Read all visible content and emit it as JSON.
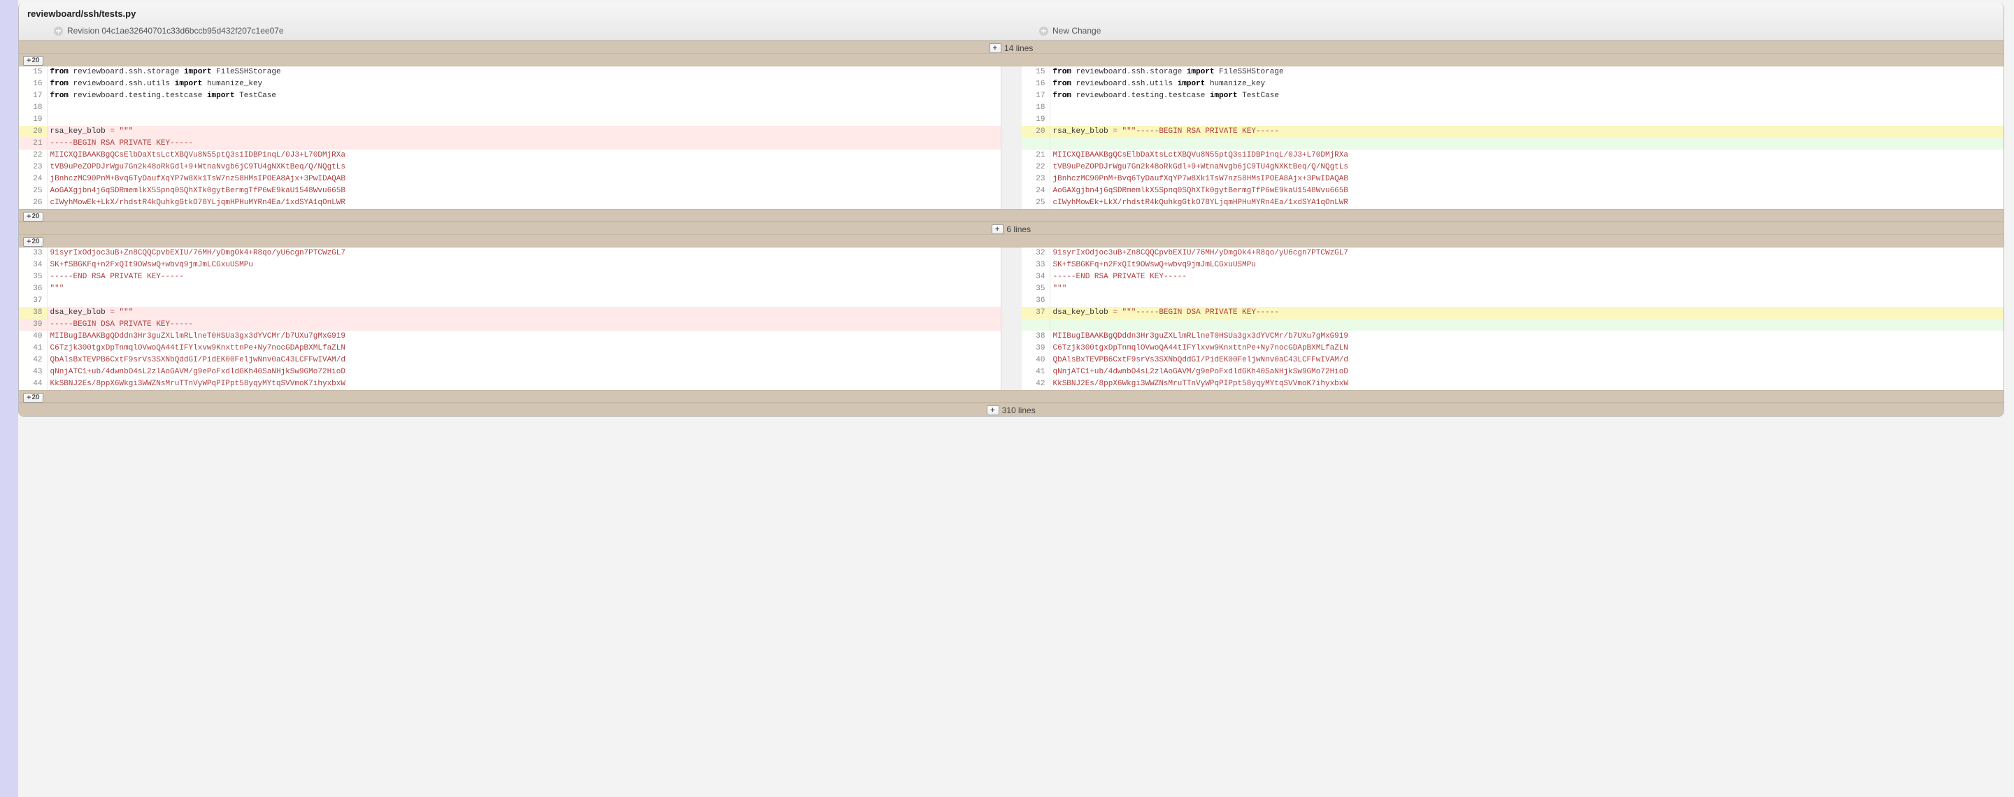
{
  "file_path": "reviewboard/ssh/tests.py",
  "revision_left_label": "Revision 04c1ae32640701c33d6bccb95d432f207c1ee07e",
  "revision_right_label": "New Change",
  "expand_top_lines": "14 lines",
  "expand_mid_lines": "6 lines",
  "expand_bottom_lines": "310 lines",
  "expand_btn_20": "20",
  "diff": {
    "rows": [
      {
        "type": "context",
        "ln_l": "15",
        "ln_r": "15",
        "l": "from reviewboard.ssh.storage import FileSSHStorage",
        "r": "from reviewboard.ssh.storage import FileSSHStorage",
        "kind": "imp"
      },
      {
        "type": "context",
        "ln_l": "16",
        "ln_r": "16",
        "l": "from reviewboard.ssh.utils import humanize_key",
        "r": "from reviewboard.ssh.utils import humanize_key",
        "kind": "imp"
      },
      {
        "type": "context",
        "ln_l": "17",
        "ln_r": "17",
        "l": "from reviewboard.testing.testcase import TestCase",
        "r": "from reviewboard.testing.testcase import TestCase",
        "kind": "imp"
      },
      {
        "type": "context",
        "ln_l": "18",
        "ln_r": "18",
        "l": "",
        "r": "",
        "kind": "blank"
      },
      {
        "type": "context",
        "ln_l": "19",
        "ln_r": "19",
        "l": "",
        "r": "",
        "kind": "blank"
      },
      {
        "type": "modified",
        "ln_l": "20",
        "ln_r": "20",
        "l_var": "rsa_key_blob",
        "l_str": " = \"\"\"",
        "r_var": "rsa_key_blob",
        "r_str": " = \"\"\"-----BEGIN RSA PRIVATE KEY-----",
        "kind": "assign"
      },
      {
        "type": "removed",
        "ln_l": "21",
        "ln_r": "",
        "l": "-----BEGIN RSA PRIVATE KEY-----",
        "r": "",
        "kind": "str"
      },
      {
        "type": "context",
        "ln_l": "22",
        "ln_r": "21",
        "l": "MIICXQIBAAKBgQCsElbDaXtsLctXBQVu8N55ptQ3s1IDBP1nqL/0J3+L70DMjRXa",
        "r": "MIICXQIBAAKBgQCsElbDaXtsLctXBQVu8N55ptQ3s1IDBP1nqL/0J3+L70DMjRXa",
        "kind": "str"
      },
      {
        "type": "context",
        "ln_l": "23",
        "ln_r": "22",
        "l": "tVB9uPeZOPDJrWgu7Gn2k48oRkGdl+9+WtnaNvgb6jC9TU4gNXKtBeq/Q/NQgtLs",
        "r": "tVB9uPeZOPDJrWgu7Gn2k48oRkGdl+9+WtnaNvgb6jC9TU4gNXKtBeq/Q/NQgtLs",
        "kind": "str"
      },
      {
        "type": "context",
        "ln_l": "24",
        "ln_r": "23",
        "l": "jBnhczMC90PnM+Bvq6TyDaufXqYP7w8Xk1TsW7nz58HMsIPOEA8Ajx+3PwIDAQAB",
        "r": "jBnhczMC90PnM+Bvq6TyDaufXqYP7w8Xk1TsW7nz58HMsIPOEA8Ajx+3PwIDAQAB",
        "kind": "str"
      },
      {
        "type": "context",
        "ln_l": "25",
        "ln_r": "24",
        "l": "AoGAXgjbn4j6qSDRmemlkX5Spnq0SQhXTk0gytBermgTfP6wE9kaU1548Wvu665B",
        "r": "AoGAXgjbn4j6qSDRmemlkX5Spnq0SQhXTk0gytBermgTfP6wE9kaU1548Wvu665B",
        "kind": "str"
      },
      {
        "type": "context",
        "ln_l": "26",
        "ln_r": "25",
        "l": "cIWyhMowEk+LkX/rhdstR4kQuhkgGtkO78YLjqmHPHuMYRn4Ea/1xdSYA1qOnLWR",
        "r": "cIWyhMowEk+LkX/rhdstR4kQuhkgGtkO78YLjqmHPHuMYRn4Ea/1xdSYA1qOnLWR",
        "kind": "str"
      }
    ],
    "rows2": [
      {
        "type": "context",
        "ln_l": "33",
        "ln_r": "32",
        "l": "91syrIxOdjoc3uB+Zn8CQQCpvbEXIU/76MH/yDmgOk4+R8qo/yU6cgn7PTCWzGL7",
        "r": "91syrIxOdjoc3uB+Zn8CQQCpvbEXIU/76MH/yDmgOk4+R8qo/yU6cgn7PTCWzGL7",
        "kind": "str"
      },
      {
        "type": "context",
        "ln_l": "34",
        "ln_r": "33",
        "l": "SK+fSBGKFq+n2FxQIt9OWswQ+wbvq9jmJmLCGxuUSMPu",
        "r": "SK+fSBGKFq+n2FxQIt9OWswQ+wbvq9jmJmLCGxuUSMPu",
        "kind": "str"
      },
      {
        "type": "context",
        "ln_l": "35",
        "ln_r": "34",
        "l": "-----END RSA PRIVATE KEY-----",
        "r": "-----END RSA PRIVATE KEY-----",
        "kind": "str"
      },
      {
        "type": "context",
        "ln_l": "36",
        "ln_r": "35",
        "l": "\"\"\"",
        "r": "\"\"\"",
        "kind": "str"
      },
      {
        "type": "context",
        "ln_l": "37",
        "ln_r": "36",
        "l": "",
        "r": "",
        "kind": "blank"
      },
      {
        "type": "modified",
        "ln_l": "38",
        "ln_r": "37",
        "l_var": "dsa_key_blob",
        "l_str": " = \"\"\"",
        "r_var": "dsa_key_blob",
        "r_str": " = \"\"\"-----BEGIN DSA PRIVATE KEY-----",
        "kind": "assign"
      },
      {
        "type": "removed",
        "ln_l": "39",
        "ln_r": "",
        "l": "-----BEGIN DSA PRIVATE KEY-----",
        "r": "",
        "kind": "str"
      },
      {
        "type": "context",
        "ln_l": "40",
        "ln_r": "38",
        "l": "MIIBugIBAAKBgQDddn3Hr3guZXLlmRLlneT0HSUa3gx3dYVCMr/b7UXu7gMxG919",
        "r": "MIIBugIBAAKBgQDddn3Hr3guZXLlmRLlneT0HSUa3gx3dYVCMr/b7UXu7gMxG919",
        "kind": "str"
      },
      {
        "type": "context",
        "ln_l": "41",
        "ln_r": "39",
        "l": "C6Tzjk300tgxDpTnmqlOVwoQA44tIFYlxvw9KnxttnPe+Ny7nocGDApBXMLfaZLN",
        "r": "C6Tzjk300tgxDpTnmqlOVwoQA44tIFYlxvw9KnxttnPe+Ny7nocGDApBXMLfaZLN",
        "kind": "str"
      },
      {
        "type": "context",
        "ln_l": "42",
        "ln_r": "40",
        "l": "QbAlsBxTEVPB6CxtF9srVs3SXNbQddGI/PidEK00FeljwNnv0aC43LCFFwIVAM/d",
        "r": "QbAlsBxTEVPB6CxtF9srVs3SXNbQddGI/PidEK00FeljwNnv0aC43LCFFwIVAM/d",
        "kind": "str"
      },
      {
        "type": "context",
        "ln_l": "43",
        "ln_r": "41",
        "l": "qNnjATC1+ub/4dwnbO4sL2zlAoGAVM/g9ePoFxdldGKh40SaNHjkSw9GMo72HioD",
        "r": "qNnjATC1+ub/4dwnbO4sL2zlAoGAVM/g9ePoFxdldGKh40SaNHjkSw9GMo72HioD",
        "kind": "str"
      },
      {
        "type": "context",
        "ln_l": "44",
        "ln_r": "42",
        "l": "KkSBNJ2Es/8ppX6Wkgi3WWZNsMruTTnVyWPqPIPpt58yqyMYtqSVVmoK7ihyxbxW",
        "r": "KkSBNJ2Es/8ppX6Wkgi3WWZNsMruTTnVyWPqPIPpt58yqyMYtqSVVmoK7ihyxbxW",
        "kind": "str"
      }
    ]
  }
}
